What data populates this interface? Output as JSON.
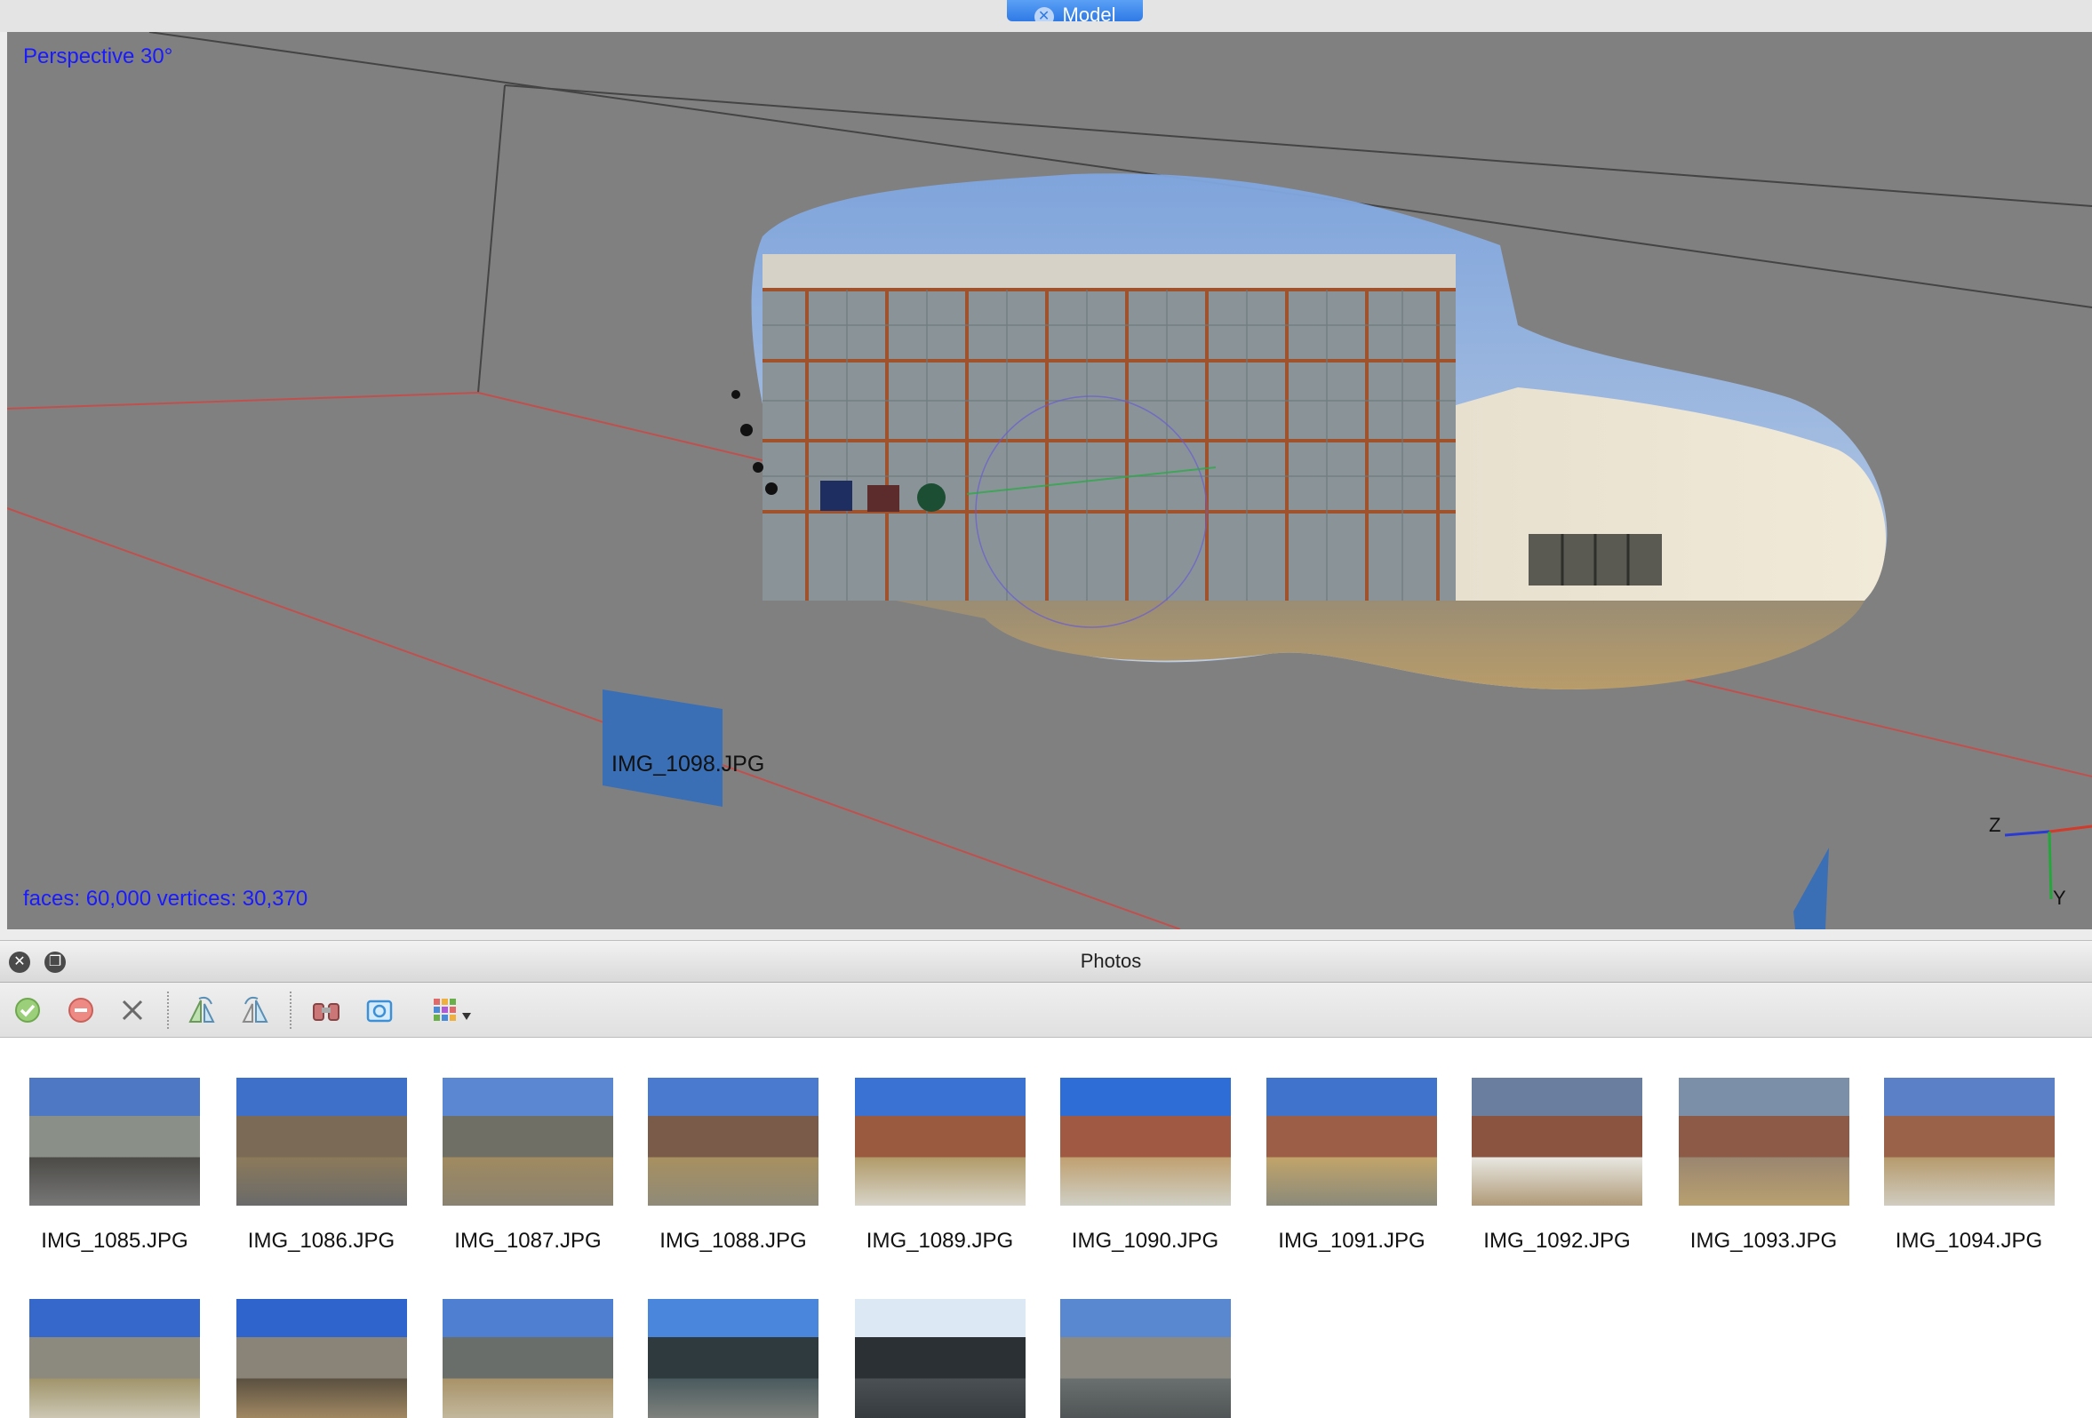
{
  "model_tab": {
    "label": "Model",
    "close_glyph": "✕"
  },
  "viewport": {
    "projection": "Perspective 30°",
    "stats": "faces: 60,000 vertices: 30,370",
    "camera_label": "IMG_1098.JPG",
    "axis_labels": {
      "z": "Z",
      "y": "Y"
    },
    "colors": {
      "background": "#808080",
      "grid": "#444444",
      "ground_line": "#c0504d",
      "camera": "#3a6fb5",
      "overlay_text": "#1a1aff"
    }
  },
  "photos_panel": {
    "title": "Photos",
    "close_glyph": "✕",
    "restore_glyph": "❐",
    "toolbar": [
      {
        "name": "enable-photos-button",
        "icon": "check-circle-icon"
      },
      {
        "name": "disable-photos-button",
        "icon": "minus-circle-icon"
      },
      {
        "name": "remove-photos-button",
        "icon": "x-icon"
      },
      {
        "name": "rotate-right-button",
        "icon": "rotate-right-icon"
      },
      {
        "name": "rotate-left-button",
        "icon": "rotate-left-icon"
      },
      {
        "name": "reset-filter-button",
        "icon": "binoculars-icon"
      },
      {
        "name": "view-photo-button",
        "icon": "camera-icon"
      },
      {
        "name": "view-mode-dropdown",
        "icon": "grid-icon"
      }
    ],
    "photos": [
      {
        "filename": "IMG_1085.JPG"
      },
      {
        "filename": "IMG_1086.JPG"
      },
      {
        "filename": "IMG_1087.JPG"
      },
      {
        "filename": "IMG_1088.JPG"
      },
      {
        "filename": "IMG_1089.JPG"
      },
      {
        "filename": "IMG_1090.JPG"
      },
      {
        "filename": "IMG_1091.JPG"
      },
      {
        "filename": "IMG_1092.JPG"
      },
      {
        "filename": "IMG_1093.JPG"
      },
      {
        "filename": "IMG_1094.JPG"
      },
      {
        "filename": ""
      },
      {
        "filename": ""
      },
      {
        "filename": ""
      },
      {
        "filename": ""
      },
      {
        "filename": ""
      },
      {
        "filename": ""
      }
    ]
  }
}
